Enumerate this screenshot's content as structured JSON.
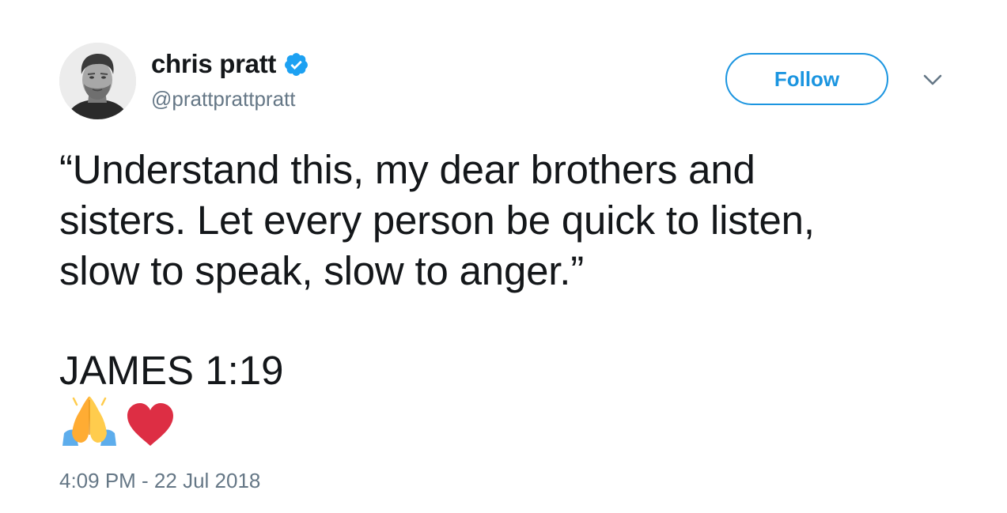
{
  "author": {
    "display_name": "chris pratt",
    "handle": "@prattprattpratt",
    "verified": true,
    "avatar_icon": "profile-photo"
  },
  "follow_button": {
    "label": "Follow"
  },
  "menu": {
    "icon": "chevron-down-icon"
  },
  "tweet": {
    "text_lines": [
      "“Understand this, my dear brothers and",
      "sisters. Let every person be quick to listen,",
      "slow to speak, slow to anger.”"
    ],
    "reference": "JAMES 1:19",
    "emojis": [
      "folded-hands",
      "red-heart"
    ]
  },
  "timestamp": "4:09 PM - 22 Jul 2018",
  "colors": {
    "text": "#14171a",
    "secondary": "#657786",
    "accent": "#1b95e0",
    "verified": "#1da1f2",
    "heart": "#dd2e44"
  }
}
